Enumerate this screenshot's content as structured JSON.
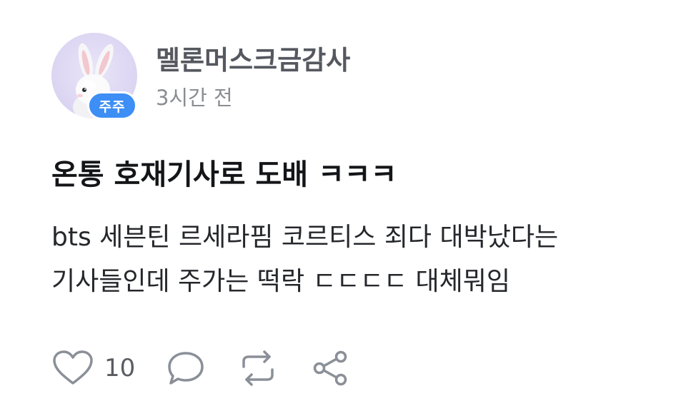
{
  "post": {
    "author": {
      "name": "멜론머스크금감사",
      "badge": "주주"
    },
    "time": "3시간 전",
    "title": "온통 호재기사로 도배 ㅋㅋㅋ",
    "body_lines": [
      "bts 세븐틴 르세라핌 코르티스 죄다 대박났다는",
      "기사들인데 주가는 떡락 ㄷㄷㄷㄷ 대체뭐임"
    ],
    "actions": {
      "like_count": "10"
    }
  },
  "icons": {
    "like": "heart-icon",
    "comment": "comment-bubble-icon",
    "repost": "repost-icon",
    "share": "share-icon"
  },
  "colors": {
    "badge": "#3d8ef5",
    "icon": "#8a8f98",
    "avatar_bg": "#ddd7f3"
  }
}
